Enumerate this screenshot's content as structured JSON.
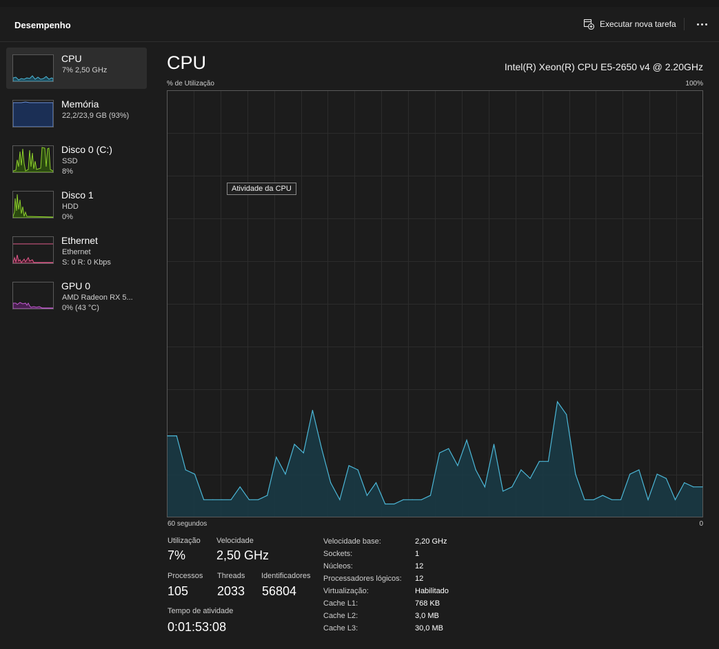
{
  "header": {
    "title": "Desempenho",
    "run_task_label": "Executar nova tarefa"
  },
  "sidebar": {
    "items": [
      {
        "name": "CPU",
        "line1": "7%  2,50 GHz",
        "line2": "",
        "color": "#4cb8d8"
      },
      {
        "name": "Memória",
        "line1": "22,2/23,9 GB (93%)",
        "line2": "",
        "color": "#6a8fd8"
      },
      {
        "name": "Disco 0 (C:)",
        "line1": "SSD",
        "line2": "8%",
        "color": "#8ccd2c"
      },
      {
        "name": "Disco 1",
        "line1": "HDD",
        "line2": "0%",
        "color": "#8ccd2c"
      },
      {
        "name": "Ethernet",
        "line1": "Ethernet",
        "line2": "S: 0 R: 0 Kbps",
        "color": "#e05a8a"
      },
      {
        "name": "GPU 0",
        "line1": "AMD Radeon RX 5...",
        "line2": "0% (43 °C)",
        "color": "#c25ad0"
      }
    ]
  },
  "main": {
    "title": "CPU",
    "model": "Intel(R) Xeon(R) CPU E5-2650 v4 @ 2.20GHz",
    "y_axis_label": "% de Utilização",
    "y_max_label": "100%",
    "x_left_label": "60 segundos",
    "x_right_label": "0",
    "tooltip": "Atividade da CPU"
  },
  "chart_data": {
    "type": "area",
    "x_label": "60 segundos",
    "y_label": "% de Utilização",
    "ylim": [
      0,
      100
    ],
    "grid": true,
    "color": "#4cb8d8",
    "values": [
      19,
      19,
      11,
      10,
      4,
      4,
      4,
      4,
      7,
      4,
      4,
      5,
      14,
      10,
      17,
      15,
      25,
      16,
      8,
      4,
      12,
      11,
      5,
      8,
      3,
      3,
      4,
      4,
      4,
      5,
      15,
      16,
      12,
      18,
      11,
      7,
      17,
      6,
      7,
      11,
      9,
      13,
      13,
      27,
      24,
      10,
      4,
      4,
      5,
      4,
      4,
      10,
      11,
      4,
      10,
      9,
      4,
      8,
      7,
      7
    ]
  },
  "stats": {
    "utilization": {
      "label": "Utilização",
      "value": "7%"
    },
    "speed": {
      "label": "Velocidade",
      "value": "2,50 GHz"
    },
    "processes": {
      "label": "Processos",
      "value": "105"
    },
    "threads": {
      "label": "Threads",
      "value": "2033"
    },
    "handles": {
      "label": "Identificadores",
      "value": "56804"
    },
    "uptime": {
      "label": "Tempo de atividade",
      "value": "0:01:53:08"
    }
  },
  "specs": [
    {
      "key": "Velocidade base:",
      "value": "2,20 GHz"
    },
    {
      "key": "Sockets:",
      "value": "1"
    },
    {
      "key": "Núcleos:",
      "value": "12"
    },
    {
      "key": "Processadores lógicos:",
      "value": "12"
    },
    {
      "key": "Virtualização:",
      "value": "Habilitado"
    },
    {
      "key": "Cache L1:",
      "value": "768 KB"
    },
    {
      "key": "Cache L2:",
      "value": "3,0 MB"
    },
    {
      "key": "Cache L3:",
      "value": "30,0 MB"
    }
  ]
}
